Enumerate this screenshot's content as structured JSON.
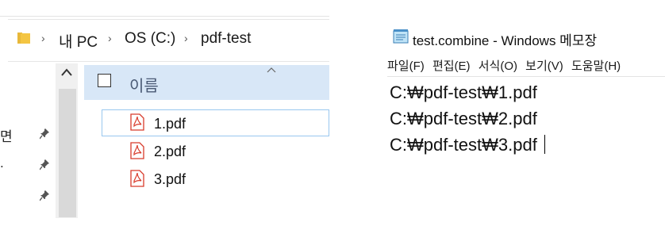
{
  "explorer": {
    "breadcrumbs": [
      "내 PC",
      "OS (C:)",
      "pdf-test"
    ],
    "breadcrumb_separator": "›",
    "column_header": "이름",
    "files": [
      "1.pdf",
      "2.pdf",
      "3.pdf"
    ],
    "nav_fragments": [
      "면",
      "."
    ],
    "icons": [
      "folder-icon",
      "chevron-right-icon",
      "pin-icon",
      "pdf-file-icon",
      "scroll-up-icon",
      "sort-ascending-icon"
    ],
    "colors": {
      "selection": "#d8e7f7",
      "selected_border": "#99c7ef",
      "pdf_red": "#d83b2b",
      "folder_yellow": "#f4c542"
    }
  },
  "notepad": {
    "title": "test.combine - Windows 메모장",
    "menu": [
      "파일(F)",
      "편집(E)",
      "서식(O)",
      "보기(V)",
      "도움말(H)"
    ],
    "lines": [
      "C:₩pdf-test₩1.pdf",
      "C:₩pdf-test₩2.pdf",
      "C:₩pdf-test₩3.pdf"
    ]
  }
}
